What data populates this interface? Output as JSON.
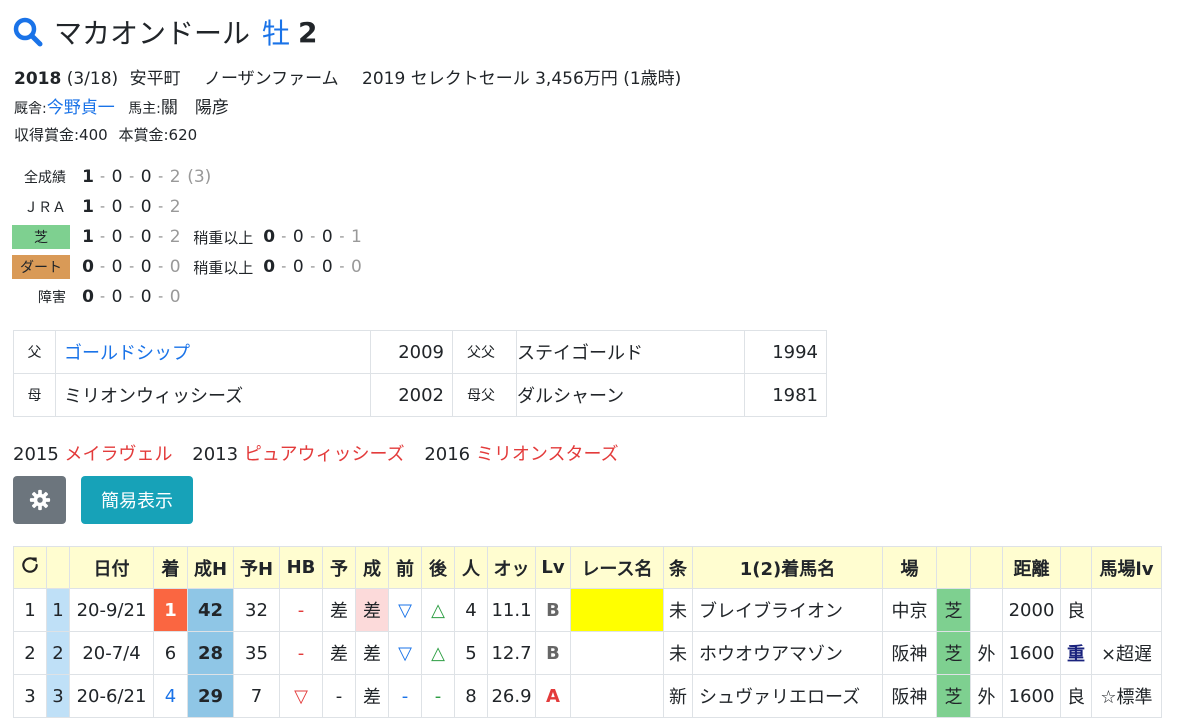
{
  "horse": {
    "name": "マカオンドール",
    "sex": "牡",
    "age": "2",
    "birth_year": "2018",
    "birth_date": "(3/18)",
    "origin": "安平町",
    "breeder": "ノーザンファーム",
    "sale": "2019 セレクトセール 3,456万円 (1歳時)",
    "stable_label": "厩舎:",
    "trainer": "今野貞一",
    "owner_label": "馬主:",
    "owner": "關　陽彦",
    "prize": "収得賞金:400",
    "main_prize": "本賞金:620"
  },
  "records": {
    "all": {
      "label": "全成績",
      "v": [
        "1",
        "0",
        "0",
        "2"
      ],
      "extra": "(3)"
    },
    "jra": {
      "label": "ＪＲＡ",
      "v": [
        "1",
        "0",
        "0",
        "2"
      ]
    },
    "turf": {
      "label": "芝",
      "v": [
        "1",
        "0",
        "0",
        "2"
      ],
      "sub_label": "稍重以上",
      "sub": [
        "0",
        "0",
        "0",
        "1"
      ]
    },
    "dirt": {
      "label": "ダート",
      "v": [
        "0",
        "0",
        "0",
        "0"
      ],
      "sub_label": "稍重以上",
      "sub": [
        "0",
        "0",
        "0",
        "0"
      ]
    },
    "jump": {
      "label": "障害",
      "v": [
        "0",
        "0",
        "0",
        "0"
      ]
    },
    "sep": "-"
  },
  "pedigree": {
    "sire_label": "父",
    "sire": "ゴールドシップ",
    "sire_year": "2009",
    "sire_sire_label": "父父",
    "sire_sire": "ステイゴールド",
    "sire_sire_year": "1994",
    "dam_label": "母",
    "dam": "ミリオンウィッシーズ",
    "dam_year": "2002",
    "dam_sire_label": "母父",
    "dam_sire": "ダルシャーン",
    "dam_sire_year": "1981"
  },
  "siblings": [
    {
      "year": "2015",
      "name": "メイラヴェル"
    },
    {
      "year": "2013",
      "name": "ピュアウィッシーズ"
    },
    {
      "year": "2016",
      "name": "ミリオンスターズ"
    }
  ],
  "buttons": {
    "gear": "gear-icon",
    "simple": "簡易表示"
  },
  "table": {
    "headers": [
      "",
      "",
      "日付",
      "着",
      "成H",
      "予H",
      "HB",
      "予",
      "成",
      "前",
      "後",
      "人",
      "オッ",
      "Lv",
      "レース名",
      "条",
      "1(2)着馬名",
      "場",
      "",
      "",
      "距離",
      "",
      "馬場lv"
    ],
    "rows": [
      {
        "n": "1",
        "k": "1",
        "date": "20-9/21",
        "rank": "1",
        "sh": "42",
        "yh": "32",
        "hb": "-",
        "yo": "差",
        "sei": "差",
        "mae": "▽",
        "ato": "△",
        "ninki": "4",
        "odds": "11.1",
        "lv": "B",
        "race": "",
        "cond": "未",
        "winner": "ブレイブライオン",
        "place": "中京",
        "surf": "芝",
        "io": "",
        "dist": "2000",
        "going": "良",
        "baba": ""
      },
      {
        "n": "2",
        "k": "2",
        "date": "20-7/4",
        "rank": "6",
        "sh": "28",
        "yh": "35",
        "hb": "-",
        "yo": "差",
        "sei": "差",
        "mae": "▽",
        "ato": "△",
        "ninki": "5",
        "odds": "12.7",
        "lv": "B",
        "race": "",
        "cond": "未",
        "winner": "ホウオウアマゾン",
        "place": "阪神",
        "surf": "芝",
        "io": "外",
        "dist": "1600",
        "going": "重",
        "baba": "×超遅"
      },
      {
        "n": "3",
        "k": "3",
        "date": "20-6/21",
        "rank": "4",
        "sh": "29",
        "yh": "7",
        "hb": "▽",
        "yo": "-",
        "sei": "差",
        "mae": "-",
        "ato": "-",
        "ninki": "8",
        "odds": "26.9",
        "lv": "A",
        "race": "",
        "cond": "新",
        "winner": "シュヴァリエローズ",
        "place": "阪神",
        "surf": "芝",
        "io": "外",
        "dist": "1600",
        "going": "良",
        "baba": "☆標準"
      }
    ]
  }
}
